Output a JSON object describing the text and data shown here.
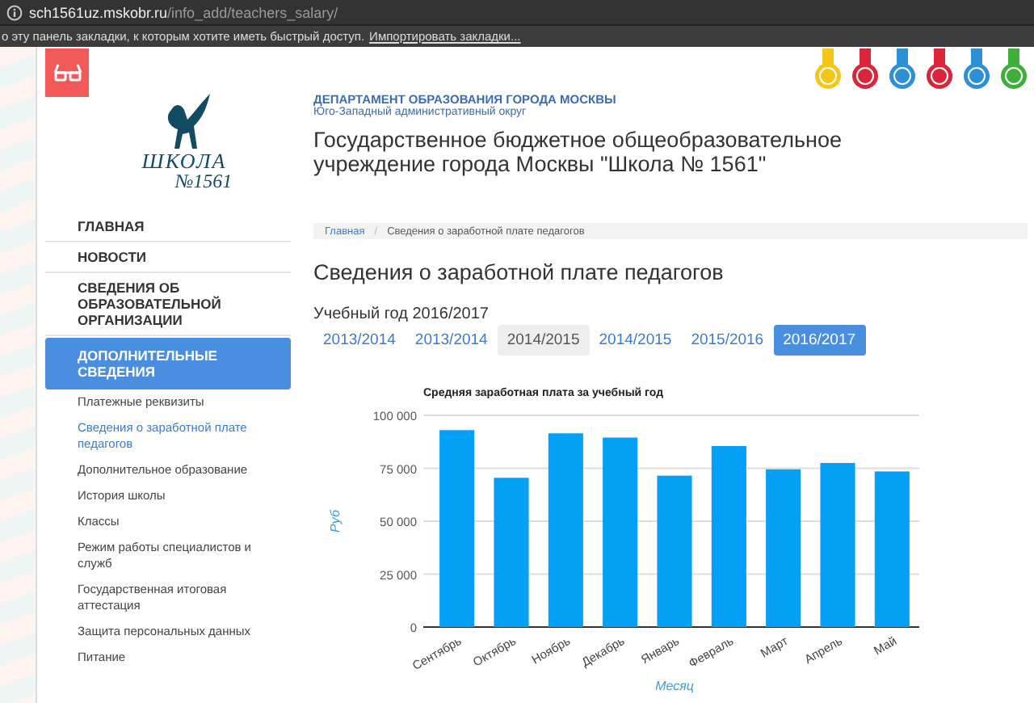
{
  "browser": {
    "url": "**sch1561uz.mskobr.ru**/info_add/teachers_salary/",
    "bookmarks_hint": "о эту панель закладки, к которым хотите иметь быстрый доступ.",
    "bookmarks_link": "Импортировать закладки..."
  },
  "logo": {
    "line_1": "ШКОЛА",
    "line_2": "№1561"
  },
  "sidebar": {
    "items": [
      {
        "label": "ГЛАВНАЯ",
        "selected": false
      },
      {
        "label": "НОВОСТИ",
        "selected": false
      },
      {
        "label": "СВЕДЕНИЯ ОБ ОБРАЗОВАТЕЛЬНОЙ ОРГАНИЗАЦИИ",
        "selected": false
      },
      {
        "label": "ДОПОЛНИТЕЛЬНЫЕ СВЕДЕНИЯ",
        "selected": true
      }
    ],
    "subitems": [
      {
        "label": "Платежные реквизиты",
        "selected": false
      },
      {
        "label": "Сведения о заработной плате педагогов",
        "selected": true
      },
      {
        "label": "Дополнительное образование",
        "selected": false
      },
      {
        "label": "История школы",
        "selected": false
      },
      {
        "label": "Классы",
        "selected": false
      },
      {
        "label": "Режим работы специалистов и служб",
        "selected": false
      },
      {
        "label": "Государственная итоговая аттестация",
        "selected": false
      },
      {
        "label": "Защита персональных данных",
        "selected": false
      },
      {
        "label": "Питание",
        "selected": false
      }
    ]
  },
  "header": {
    "department": "ДЕПАРТАМЕНТ ОБРАЗОВАНИЯ ГОРОДА МОСКВЫ",
    "district": "Юго-Западный административный округ",
    "title": "Государственное бюджетное общеобразовательное учреждение города Москвы \"Школа № 1561\""
  },
  "badges": [
    {
      "color": "#f5c518"
    },
    {
      "color": "#d9263a"
    },
    {
      "color": "#2d8fd6"
    },
    {
      "color": "#d9263a"
    },
    {
      "color": "#2d8fd6"
    },
    {
      "color": "#3fae3a"
    }
  ],
  "breadcrumb_separator": "/",
  "breadcrumb": [
    {
      "label": "Главная",
      "kind": "link"
    },
    {
      "label": "Сведения о заработной плате педагогов",
      "kind": "current"
    }
  ],
  "page_title": "Сведения о заработной плате педагогов",
  "year_label": "Учебный год 2016/2017",
  "tabs": [
    {
      "label": "2013/2014",
      "selected": false,
      "hovered": false
    },
    {
      "label": "2013/2014",
      "selected": false,
      "hovered": false
    },
    {
      "label": "2014/2015",
      "selected": false,
      "hovered": true
    },
    {
      "label": "2014/2015",
      "selected": false,
      "hovered": false
    },
    {
      "label": "2015/2016",
      "selected": false,
      "hovered": false
    },
    {
      "label": "2016/2017",
      "selected": true,
      "hovered": false
    }
  ],
  "chart": {
    "chart_data": {
      "type": "bar",
      "title": "Средняя заработная плата за учебный год",
      "xlabel": "Месяц",
      "ylabel": "Руб",
      "categories": [
        "Сентябрь",
        "Октябрь",
        "Ноябрь",
        "Декабрь",
        "Январь",
        "Февраль",
        "Март",
        "Апрель",
        "Май"
      ],
      "grid": true,
      "series": [
        {
          "color": "#03a0f5",
          "values": [
            93000,
            70500,
            91500,
            89500,
            71500,
            85500,
            74500,
            77500,
            73500
          ]
        }
      ],
      "ylim": [
        0,
        100000
      ],
      "yticks": [
        {
          "value": 0,
          "label": "0"
        },
        {
          "value": 25000,
          "label": "25 000"
        },
        {
          "value": 50000,
          "label": "50 000"
        },
        {
          "value": 75000,
          "label": "75 000"
        },
        {
          "value": 100000,
          "label": "100 000"
        }
      ]
    }
  }
}
